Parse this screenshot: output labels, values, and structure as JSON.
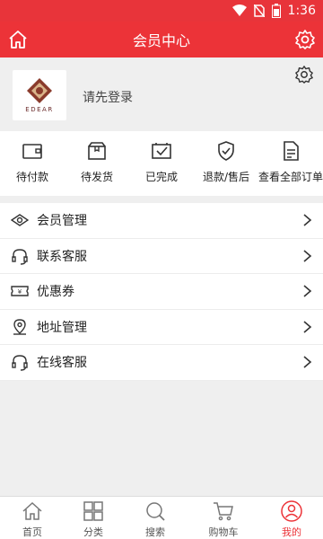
{
  "status_bar": {
    "time": "1:36"
  },
  "header": {
    "title": "会员中心"
  },
  "profile": {
    "brand_text": "EDEAR",
    "login_prompt": "请先登录"
  },
  "orders": [
    {
      "label": "待付款",
      "icon": "wallet-icon"
    },
    {
      "label": "待发货",
      "icon": "box-icon"
    },
    {
      "label": "已完成",
      "icon": "checkbox-icon"
    },
    {
      "label": "退款/售后",
      "icon": "shield-check-icon"
    },
    {
      "label": "查看全部订单",
      "icon": "document-icon"
    }
  ],
  "menu": [
    {
      "label": "会员管理",
      "icon": "diamond-eye-icon"
    },
    {
      "label": "联系客服",
      "icon": "headset-icon"
    },
    {
      "label": "优惠券",
      "icon": "coupon-icon"
    },
    {
      "label": "地址管理",
      "icon": "location-icon"
    },
    {
      "label": "在线客服",
      "icon": "headset-icon"
    }
  ],
  "tabs": [
    {
      "label": "首页",
      "icon": "home-icon"
    },
    {
      "label": "分类",
      "icon": "grid-icon"
    },
    {
      "label": "搜索",
      "icon": "search-icon"
    },
    {
      "label": "购物车",
      "icon": "cart-icon"
    },
    {
      "label": "我的",
      "icon": "user-icon",
      "active": true
    }
  ],
  "colors": {
    "brand_red": "#ec3338",
    "background": "#efefef"
  }
}
